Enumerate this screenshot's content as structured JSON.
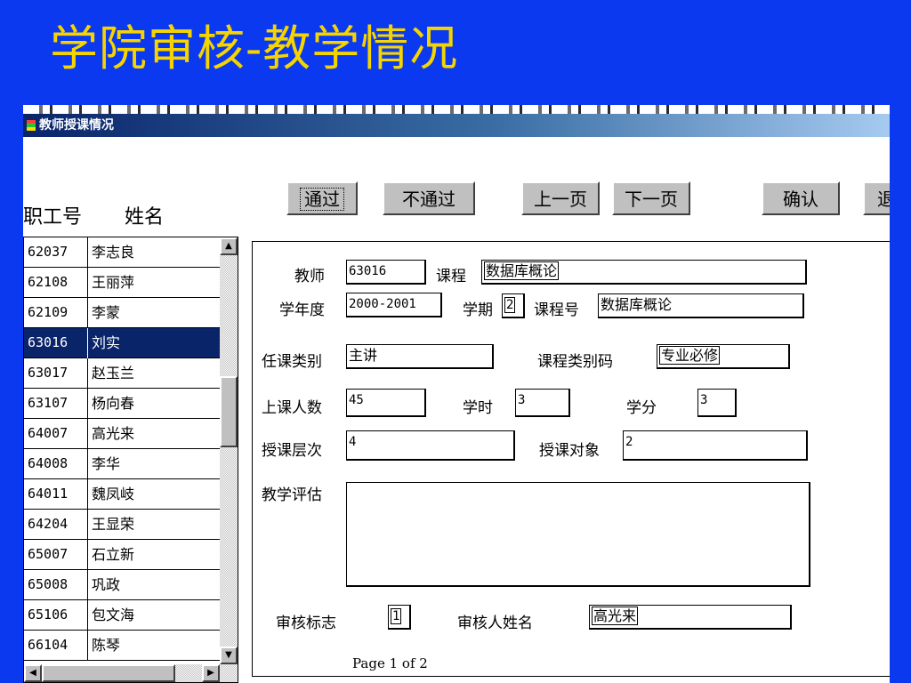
{
  "slide": {
    "title": "学院审核-教学情况"
  },
  "window": {
    "title": "教师授课情况"
  },
  "toolbar": {
    "pass": "通过",
    "reject": "不通过",
    "prev_page": "上一页",
    "next_page": "下一页",
    "confirm": "确认",
    "exit_partial": "退"
  },
  "list": {
    "header_id": "职工号",
    "header_name": "姓名",
    "rows": [
      {
        "id": "62037",
        "name": "李志良"
      },
      {
        "id": "62108",
        "name": "王丽萍"
      },
      {
        "id": "62109",
        "name": "李蒙"
      },
      {
        "id": "63016",
        "name": "刘实"
      },
      {
        "id": "63017",
        "name": "赵玉兰"
      },
      {
        "id": "63107",
        "name": "杨向春"
      },
      {
        "id": "64007",
        "name": "高光来"
      },
      {
        "id": "64008",
        "name": "李华"
      },
      {
        "id": "64011",
        "name": "魏凤岐"
      },
      {
        "id": "64204",
        "name": "王显荣"
      },
      {
        "id": "65007",
        "name": "石立新"
      },
      {
        "id": "65008",
        "name": "巩政"
      },
      {
        "id": "65106",
        "name": "包文海"
      },
      {
        "id": "66104",
        "name": "陈琴"
      }
    ],
    "selected_index": 3
  },
  "form": {
    "teacher_label": "教师",
    "teacher_value": "63016",
    "course_label": "课程",
    "course_value": "数据库概论",
    "year_label": "学年度",
    "year_value": "2000-2001",
    "term_label": "学期",
    "term_value": "2",
    "course_no_label": "课程号",
    "course_no_value": "数据库概论",
    "role_label": "任课类别",
    "role_value": "主讲",
    "course_type_label": "课程类别码",
    "course_type_value": "专业必修",
    "students_label": "上课人数",
    "students_value": "45",
    "hours_label": "学时",
    "hours_value": "3",
    "credits_label": "学分",
    "credits_value": "3",
    "level_label": "授课层次",
    "level_value": "4",
    "target_label": "授课对象",
    "target_value": "2",
    "eval_label": "教学评估",
    "eval_value": "",
    "audit_flag_label": "审核标志",
    "audit_flag_value": "1",
    "auditor_label": "审核人姓名",
    "auditor_value": "高光来",
    "page_info": "Page 1 of 2"
  }
}
